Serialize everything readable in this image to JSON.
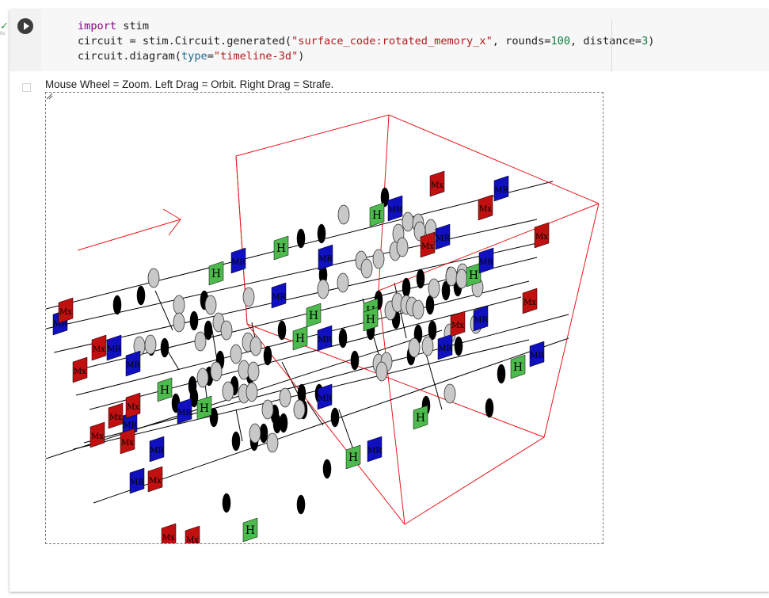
{
  "cell": {
    "run_status": "✓",
    "exec_time": "0s",
    "code_lines": [
      [
        {
          "t": "import",
          "c": "kw"
        },
        {
          "t": " stim",
          "c": ""
        }
      ],
      [
        {
          "t": "circuit = stim.Circuit.generated(",
          "c": ""
        },
        {
          "t": "\"surface_code:rotated_memory_x\"",
          "c": "str"
        },
        {
          "t": ", rounds=",
          "c": ""
        },
        {
          "t": "100",
          "c": "num"
        },
        {
          "t": ", distance=",
          "c": ""
        },
        {
          "t": "3",
          "c": "num"
        },
        {
          "t": ")",
          "c": ""
        }
      ],
      [
        {
          "t": "circuit.diagram(",
          "c": ""
        },
        {
          "t": "type",
          "c": "param"
        },
        {
          "t": "=",
          "c": ""
        },
        {
          "t": "\"timeline-3d\"",
          "c": "str"
        },
        {
          "t": ")",
          "c": ""
        }
      ]
    ]
  },
  "output": {
    "hint_text": "Mouse Wheel = Zoom. Left Drag = Orbit. Right Drag = Strafe."
  },
  "diagram": {
    "gate_labels": {
      "hadamard": "H",
      "measure_reset": "MR",
      "measure_x": "Mx"
    },
    "colors": {
      "box": "#e8171c",
      "axis_arrow": "#e8171c",
      "hadamard": "#4cba4c",
      "measure_reset": "#1010c0",
      "measure_x": "#c01010",
      "control_dot": "#000000",
      "target_dot": "#c8c8c8",
      "qubit_line": "#000000"
    }
  }
}
